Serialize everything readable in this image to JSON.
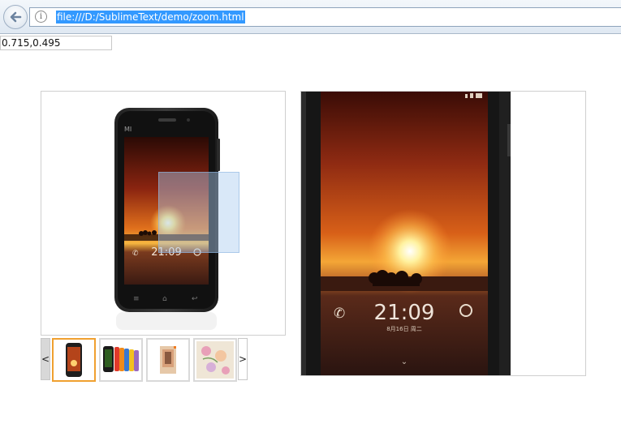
{
  "browser": {
    "address_url": "file:///D:/SublimeText/demo/zoom.html",
    "info_symbol": "i"
  },
  "readout": {
    "coordinates": "0.715,0.495"
  },
  "product": {
    "phone_brand": "MI",
    "lock_time": "21:09",
    "lock_date": "8月16日 周二"
  },
  "thumbnails": {
    "prev_label": "<",
    "next_label": ">",
    "active_index": 0,
    "count": 4
  },
  "colors": {
    "lens": "#aacdf0",
    "active_thumb_border": "#f0a030",
    "url_selection": "#3399ff"
  }
}
